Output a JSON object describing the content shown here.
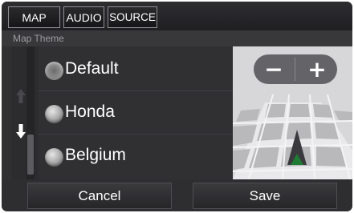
{
  "tabs": [
    {
      "label": "MAP"
    },
    {
      "label": "AUDIO"
    },
    {
      "label": "SOURCE"
    }
  ],
  "section": {
    "title": "Map Theme"
  },
  "scroll": {
    "up_icon": "arrow-up-icon",
    "down_icon": "arrow-down-icon"
  },
  "themes": {
    "selected": "Default",
    "items": [
      {
        "label": "Default"
      },
      {
        "label": "Honda"
      },
      {
        "label": "Belgium"
      }
    ]
  },
  "preview": {
    "zoom_out": "−",
    "zoom_in": "+",
    "vehicle_icon": "vehicle-arrow-icon"
  },
  "actions": {
    "cancel": "Cancel",
    "save": "Save"
  },
  "colors": {
    "background": "#333336",
    "text": "#ffffff",
    "muted": "#9c9ca0"
  }
}
